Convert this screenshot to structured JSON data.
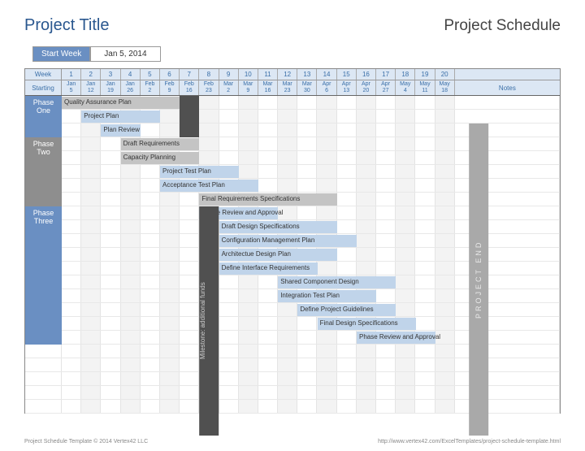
{
  "header": {
    "title": "Project Title",
    "schedule": "Project Schedule"
  },
  "startWeek": {
    "label": "Start Week",
    "value": "Jan 5, 2014"
  },
  "grid": {
    "weekLabel": "Week",
    "startingLabel": "Starting",
    "notesLabel": "Notes",
    "weeks": [
      "1",
      "2",
      "3",
      "4",
      "5",
      "6",
      "7",
      "8",
      "9",
      "10",
      "11",
      "12",
      "13",
      "14",
      "15",
      "16",
      "17",
      "18",
      "19",
      "20"
    ],
    "dates": [
      [
        "Jan",
        "5"
      ],
      [
        "Jan",
        "12"
      ],
      [
        "Jan",
        "19"
      ],
      [
        "Jan",
        "26"
      ],
      [
        "Feb",
        "2"
      ],
      [
        "Feb",
        "9"
      ],
      [
        "Feb",
        "16"
      ],
      [
        "Feb",
        "23"
      ],
      [
        "Mar",
        "2"
      ],
      [
        "Mar",
        "9"
      ],
      [
        "Mar",
        "16"
      ],
      [
        "Mar",
        "23"
      ],
      [
        "Mar",
        "30"
      ],
      [
        "Apr",
        "6"
      ],
      [
        "Apr",
        "13"
      ],
      [
        "Apr",
        "20"
      ],
      [
        "Apr",
        "27"
      ],
      [
        "May",
        "4"
      ],
      [
        "May",
        "11"
      ],
      [
        "May",
        "18"
      ]
    ]
  },
  "phases": {
    "one": "Phase\nOne",
    "two": "Phase\nTwo",
    "three": "Phase\nThree"
  },
  "milestone": {
    "m2": "Milestone: additional funds",
    "pe": "PROJECT END"
  },
  "tasks": [
    {
      "row": 0,
      "start": 1,
      "len": 6,
      "c": "g",
      "label": "Quality Assurance Plan"
    },
    {
      "row": 1,
      "start": 2,
      "len": 4,
      "c": "b",
      "label": "Project Plan"
    },
    {
      "row": 2,
      "start": 3,
      "len": 2,
      "c": "b",
      "label": "Plan Review"
    },
    {
      "row": 3,
      "start": 4,
      "len": 4,
      "c": "g",
      "label": "Draft Requirements"
    },
    {
      "row": 4,
      "start": 4,
      "len": 4,
      "c": "g",
      "label": "Capacity Planning"
    },
    {
      "row": 5,
      "start": 6,
      "len": 4,
      "c": "b",
      "label": "Project Test Plan"
    },
    {
      "row": 6,
      "start": 6,
      "len": 5,
      "c": "b",
      "label": "Acceptance Test Plan"
    },
    {
      "row": 7,
      "start": 8,
      "len": 7,
      "c": "g",
      "label": "Final Requirements Specifications"
    },
    {
      "row": 8,
      "start": 8,
      "len": 4,
      "c": "b",
      "label": "Phase Review and Approval"
    },
    {
      "row": 9,
      "start": 9,
      "len": 6,
      "c": "b",
      "label": "Draft Design Specifications"
    },
    {
      "row": 10,
      "start": 9,
      "len": 7,
      "c": "b",
      "label": "Configuration Management Plan"
    },
    {
      "row": 11,
      "start": 9,
      "len": 6,
      "c": "b",
      "label": "Architectue Design Plan"
    },
    {
      "row": 12,
      "start": 9,
      "len": 5,
      "c": "b",
      "label": "Define Interface Requirements"
    },
    {
      "row": 13,
      "start": 12,
      "len": 6,
      "c": "b",
      "label": "Shared Component Design"
    },
    {
      "row": 14,
      "start": 12,
      "len": 5,
      "c": "b",
      "label": "Integration Test Plan"
    },
    {
      "row": 15,
      "start": 13,
      "len": 5,
      "c": "b",
      "label": "Define Project Guidelines"
    },
    {
      "row": 16,
      "start": 14,
      "len": 5,
      "c": "b",
      "label": "Final Design Specifications"
    },
    {
      "row": 17,
      "start": 16,
      "len": 4,
      "c": "b",
      "label": "Phase Review and Approval"
    }
  ],
  "footer": {
    "left": "Project Schedule Template © 2014 Vertex42 LLC",
    "right": "http://www.vertex42.com/ExcelTemplates/project-schedule-template.html"
  }
}
